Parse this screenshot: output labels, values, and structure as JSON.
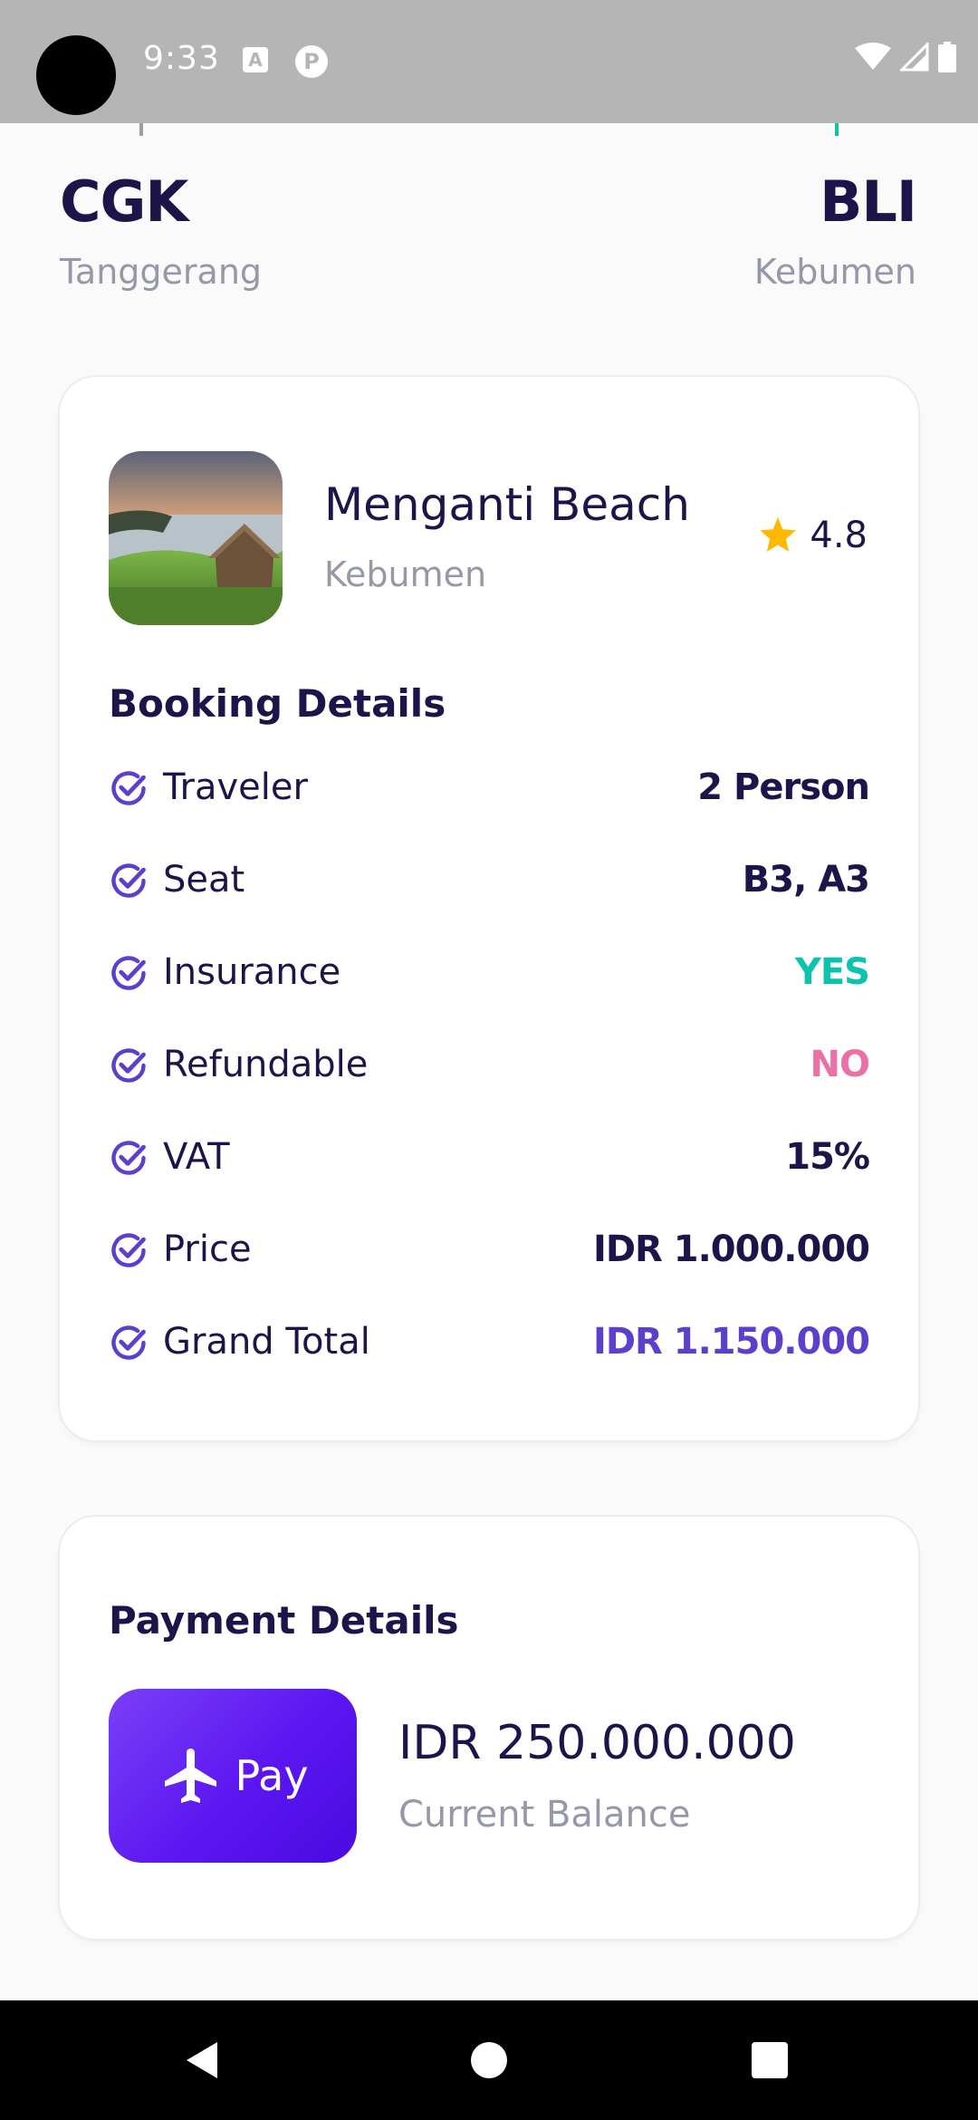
{
  "status_bar": {
    "time": "9:33",
    "icons": [
      "notification-a-icon",
      "notification-p-icon",
      "wifi-icon",
      "signal-icon",
      "battery-icon"
    ],
    "notif_a": "A",
    "notif_p": "P"
  },
  "route": {
    "from_code": "CGK",
    "from_city": "Tanggerang",
    "to_code": "BLI",
    "to_city": "Kebumen"
  },
  "destination": {
    "name": "Menganti Beach",
    "city": "Kebumen",
    "rating": "4.8",
    "image": "beach-photo"
  },
  "booking": {
    "title": "Booking Details",
    "rows": [
      {
        "label": "Traveler",
        "value": "2 Person",
        "value_color": "#1F1449"
      },
      {
        "label": "Seat",
        "value": "B3, A3",
        "value_color": "#1F1449"
      },
      {
        "label": "Insurance",
        "value": "YES",
        "value_color": "#0EC3AE"
      },
      {
        "label": "Refundable",
        "value": "NO",
        "value_color": "#EB70A5"
      },
      {
        "label": "VAT",
        "value": "15%",
        "value_color": "#1F1449"
      },
      {
        "label": "Price",
        "value": "IDR 1.000.000",
        "value_color": "#1F1449"
      },
      {
        "label": "Grand Total",
        "value": "IDR 1.150.000",
        "value_color": "#5C40CC"
      }
    ]
  },
  "payment": {
    "title": "Payment Details",
    "pay_label": "Pay",
    "balance_amount": "IDR 250.000.000",
    "balance_label": "Current Balance"
  },
  "colors": {
    "primary": "#5C40CC",
    "dark": "#1F1449",
    "grey": "#9698A9",
    "green": "#0EC3AE",
    "pink": "#EB70A5",
    "star": "#FFB800"
  }
}
